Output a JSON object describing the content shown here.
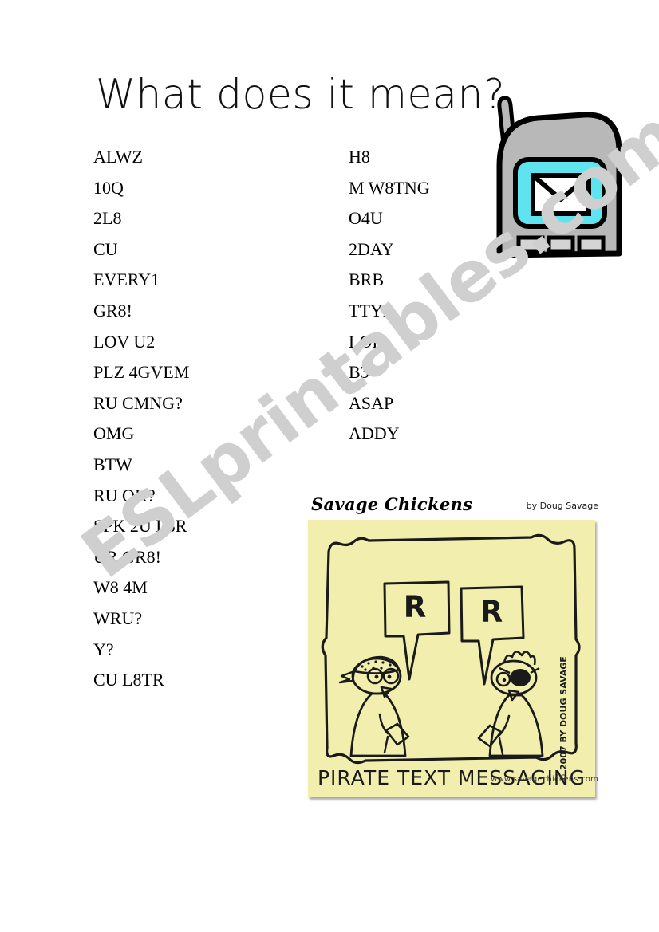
{
  "title": "What does it mean?",
  "columns": {
    "left": [
      "ALWZ",
      "10Q",
      "2L8",
      "CU",
      "EVERY1",
      "GR8!",
      "LOV U2",
      "PLZ 4GVEM",
      "RU CMNG?",
      "OMG",
      "BTW",
      "RU OK?",
      "SPK 2U L8R",
      "UR GR8!",
      "W8 4M",
      "WRU?",
      "Y?",
      "CU L8TR"
    ],
    "right": [
      "H8",
      "M W8TNG",
      "O4U",
      "2DAY",
      "BRB",
      "TTYL",
      "LOL",
      "B3",
      "ASAP",
      "ADDY"
    ]
  },
  "watermark": "ESLprintables.com",
  "phone": {
    "body_color": "#b8b8b8",
    "screen_color": "#5fe4ef",
    "envelope_color": "#ffffff",
    "button_color": "#d4d4d4",
    "outline_color": "#000000"
  },
  "comic": {
    "brand": "Savage Chickens",
    "author": "by Doug Savage",
    "caption": "PIRATE TEXT MESSAGING",
    "bubble_left": "R",
    "bubble_right": "R",
    "copyright": "© 2007 BY DOUG SAVAGE",
    "website": "www.savagechickens.com",
    "note_color": "#f2efae",
    "ink_color": "#1a1a1a"
  }
}
